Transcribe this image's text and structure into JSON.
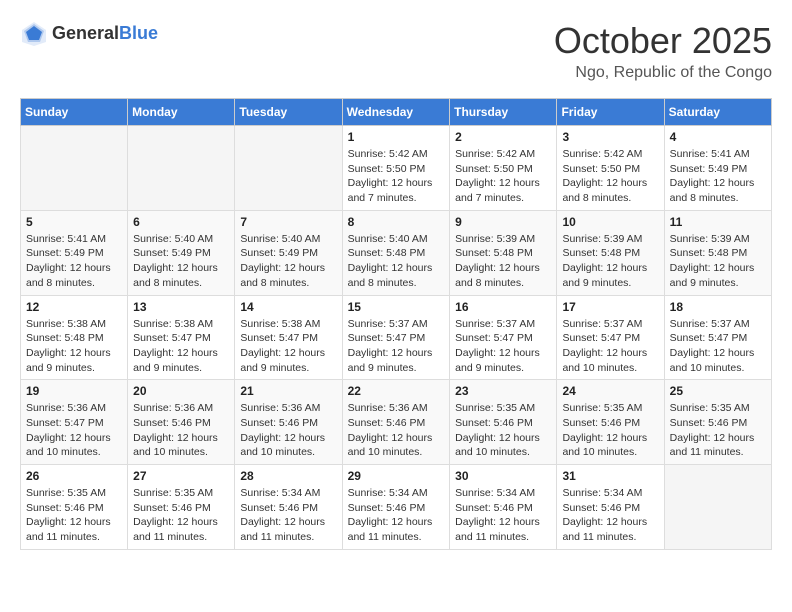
{
  "header": {
    "logo": {
      "general": "General",
      "blue": "Blue"
    },
    "title": "October 2025",
    "location": "Ngo, Republic of the Congo"
  },
  "weekdays": [
    "Sunday",
    "Monday",
    "Tuesday",
    "Wednesday",
    "Thursday",
    "Friday",
    "Saturday"
  ],
  "weeks": [
    [
      {
        "day": "",
        "sunrise": "",
        "sunset": "",
        "daylight": ""
      },
      {
        "day": "",
        "sunrise": "",
        "sunset": "",
        "daylight": ""
      },
      {
        "day": "",
        "sunrise": "",
        "sunset": "",
        "daylight": ""
      },
      {
        "day": "1",
        "sunrise": "Sunrise: 5:42 AM",
        "sunset": "Sunset: 5:50 PM",
        "daylight": "Daylight: 12 hours and 7 minutes."
      },
      {
        "day": "2",
        "sunrise": "Sunrise: 5:42 AM",
        "sunset": "Sunset: 5:50 PM",
        "daylight": "Daylight: 12 hours and 7 minutes."
      },
      {
        "day": "3",
        "sunrise": "Sunrise: 5:42 AM",
        "sunset": "Sunset: 5:50 PM",
        "daylight": "Daylight: 12 hours and 8 minutes."
      },
      {
        "day": "4",
        "sunrise": "Sunrise: 5:41 AM",
        "sunset": "Sunset: 5:49 PM",
        "daylight": "Daylight: 12 hours and 8 minutes."
      }
    ],
    [
      {
        "day": "5",
        "sunrise": "Sunrise: 5:41 AM",
        "sunset": "Sunset: 5:49 PM",
        "daylight": "Daylight: 12 hours and 8 minutes."
      },
      {
        "day": "6",
        "sunrise": "Sunrise: 5:40 AM",
        "sunset": "Sunset: 5:49 PM",
        "daylight": "Daylight: 12 hours and 8 minutes."
      },
      {
        "day": "7",
        "sunrise": "Sunrise: 5:40 AM",
        "sunset": "Sunset: 5:49 PM",
        "daylight": "Daylight: 12 hours and 8 minutes."
      },
      {
        "day": "8",
        "sunrise": "Sunrise: 5:40 AM",
        "sunset": "Sunset: 5:48 PM",
        "daylight": "Daylight: 12 hours and 8 minutes."
      },
      {
        "day": "9",
        "sunrise": "Sunrise: 5:39 AM",
        "sunset": "Sunset: 5:48 PM",
        "daylight": "Daylight: 12 hours and 8 minutes."
      },
      {
        "day": "10",
        "sunrise": "Sunrise: 5:39 AM",
        "sunset": "Sunset: 5:48 PM",
        "daylight": "Daylight: 12 hours and 9 minutes."
      },
      {
        "day": "11",
        "sunrise": "Sunrise: 5:39 AM",
        "sunset": "Sunset: 5:48 PM",
        "daylight": "Daylight: 12 hours and 9 minutes."
      }
    ],
    [
      {
        "day": "12",
        "sunrise": "Sunrise: 5:38 AM",
        "sunset": "Sunset: 5:48 PM",
        "daylight": "Daylight: 12 hours and 9 minutes."
      },
      {
        "day": "13",
        "sunrise": "Sunrise: 5:38 AM",
        "sunset": "Sunset: 5:47 PM",
        "daylight": "Daylight: 12 hours and 9 minutes."
      },
      {
        "day": "14",
        "sunrise": "Sunrise: 5:38 AM",
        "sunset": "Sunset: 5:47 PM",
        "daylight": "Daylight: 12 hours and 9 minutes."
      },
      {
        "day": "15",
        "sunrise": "Sunrise: 5:37 AM",
        "sunset": "Sunset: 5:47 PM",
        "daylight": "Daylight: 12 hours and 9 minutes."
      },
      {
        "day": "16",
        "sunrise": "Sunrise: 5:37 AM",
        "sunset": "Sunset: 5:47 PM",
        "daylight": "Daylight: 12 hours and 9 minutes."
      },
      {
        "day": "17",
        "sunrise": "Sunrise: 5:37 AM",
        "sunset": "Sunset: 5:47 PM",
        "daylight": "Daylight: 12 hours and 10 minutes."
      },
      {
        "day": "18",
        "sunrise": "Sunrise: 5:37 AM",
        "sunset": "Sunset: 5:47 PM",
        "daylight": "Daylight: 12 hours and 10 minutes."
      }
    ],
    [
      {
        "day": "19",
        "sunrise": "Sunrise: 5:36 AM",
        "sunset": "Sunset: 5:47 PM",
        "daylight": "Daylight: 12 hours and 10 minutes."
      },
      {
        "day": "20",
        "sunrise": "Sunrise: 5:36 AM",
        "sunset": "Sunset: 5:46 PM",
        "daylight": "Daylight: 12 hours and 10 minutes."
      },
      {
        "day": "21",
        "sunrise": "Sunrise: 5:36 AM",
        "sunset": "Sunset: 5:46 PM",
        "daylight": "Daylight: 12 hours and 10 minutes."
      },
      {
        "day": "22",
        "sunrise": "Sunrise: 5:36 AM",
        "sunset": "Sunset: 5:46 PM",
        "daylight": "Daylight: 12 hours and 10 minutes."
      },
      {
        "day": "23",
        "sunrise": "Sunrise: 5:35 AM",
        "sunset": "Sunset: 5:46 PM",
        "daylight": "Daylight: 12 hours and 10 minutes."
      },
      {
        "day": "24",
        "sunrise": "Sunrise: 5:35 AM",
        "sunset": "Sunset: 5:46 PM",
        "daylight": "Daylight: 12 hours and 10 minutes."
      },
      {
        "day": "25",
        "sunrise": "Sunrise: 5:35 AM",
        "sunset": "Sunset: 5:46 PM",
        "daylight": "Daylight: 12 hours and 11 minutes."
      }
    ],
    [
      {
        "day": "26",
        "sunrise": "Sunrise: 5:35 AM",
        "sunset": "Sunset: 5:46 PM",
        "daylight": "Daylight: 12 hours and 11 minutes."
      },
      {
        "day": "27",
        "sunrise": "Sunrise: 5:35 AM",
        "sunset": "Sunset: 5:46 PM",
        "daylight": "Daylight: 12 hours and 11 minutes."
      },
      {
        "day": "28",
        "sunrise": "Sunrise: 5:34 AM",
        "sunset": "Sunset: 5:46 PM",
        "daylight": "Daylight: 12 hours and 11 minutes."
      },
      {
        "day": "29",
        "sunrise": "Sunrise: 5:34 AM",
        "sunset": "Sunset: 5:46 PM",
        "daylight": "Daylight: 12 hours and 11 minutes."
      },
      {
        "day": "30",
        "sunrise": "Sunrise: 5:34 AM",
        "sunset": "Sunset: 5:46 PM",
        "daylight": "Daylight: 12 hours and 11 minutes."
      },
      {
        "day": "31",
        "sunrise": "Sunrise: 5:34 AM",
        "sunset": "Sunset: 5:46 PM",
        "daylight": "Daylight: 12 hours and 11 minutes."
      },
      {
        "day": "",
        "sunrise": "",
        "sunset": "",
        "daylight": ""
      }
    ]
  ]
}
